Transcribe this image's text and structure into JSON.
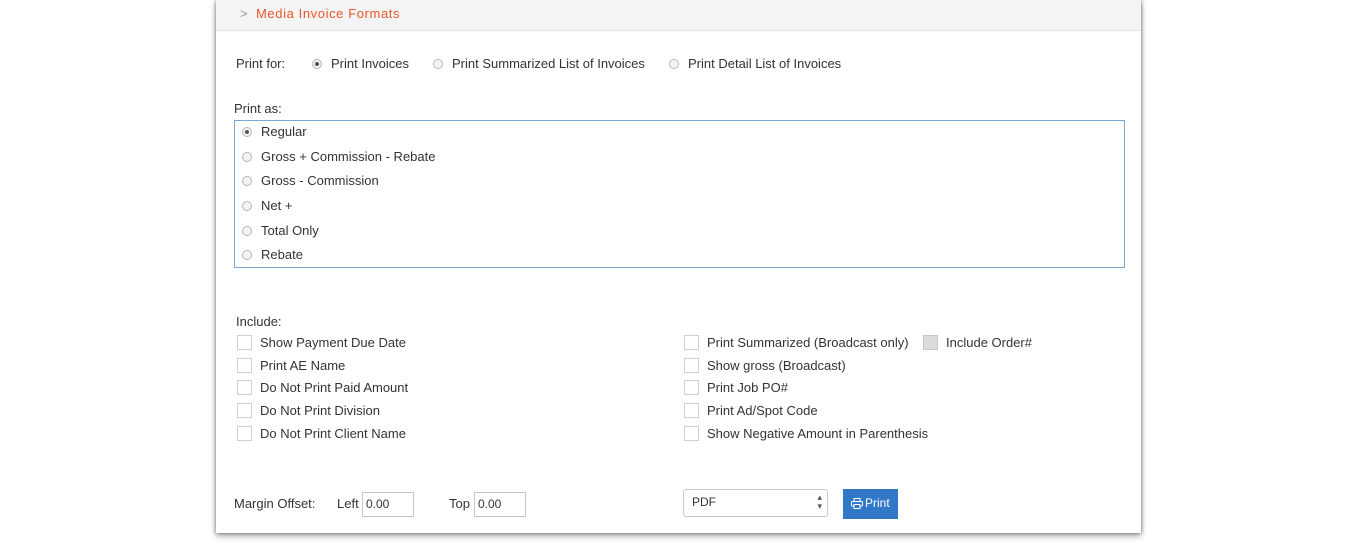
{
  "header": {
    "chevron": ">",
    "title": "Media Invoice Formats"
  },
  "print_for": {
    "label": "Print for:",
    "options": [
      {
        "label": "Print Invoices",
        "checked": true
      },
      {
        "label": "Print Summarized List of Invoices",
        "checked": false
      },
      {
        "label": "Print Detail List of Invoices",
        "checked": false
      }
    ]
  },
  "print_as": {
    "label": "Print as:",
    "options": [
      {
        "label": "Regular",
        "checked": true
      },
      {
        "label": "Gross + Commission - Rebate",
        "checked": false
      },
      {
        "label": "Gross - Commission",
        "checked": false
      },
      {
        "label": "Net +",
        "checked": false
      },
      {
        "label": "Total Only",
        "checked": false
      },
      {
        "label": "Rebate",
        "checked": false
      }
    ]
  },
  "include": {
    "label": "Include:",
    "left": [
      {
        "label": "Show Payment Due Date",
        "checked": false
      },
      {
        "label": "Print AE Name",
        "checked": false
      },
      {
        "label": "Do Not Print Paid Amount",
        "checked": false
      },
      {
        "label": "Do Not Print Division",
        "checked": false
      },
      {
        "label": "Do Not Print Client Name",
        "checked": false
      }
    ],
    "right": [
      {
        "label": "Print Summarized (Broadcast only)",
        "checked": false
      },
      {
        "label": "Show gross (Broadcast)",
        "checked": false
      },
      {
        "label": "Print Job PO#",
        "checked": false
      },
      {
        "label": "Print Ad/Spot Code",
        "checked": false
      },
      {
        "label": "Show Negative Amount in Parenthesis",
        "checked": false
      }
    ],
    "extra": {
      "label": "Include Order#",
      "checked": false
    }
  },
  "margin": {
    "label": "Margin Offset:",
    "left_label": "Left",
    "left_value": "0.00",
    "top_label": "Top",
    "top_value": "0.00"
  },
  "output": {
    "format": "PDF",
    "print_label": "Print"
  }
}
